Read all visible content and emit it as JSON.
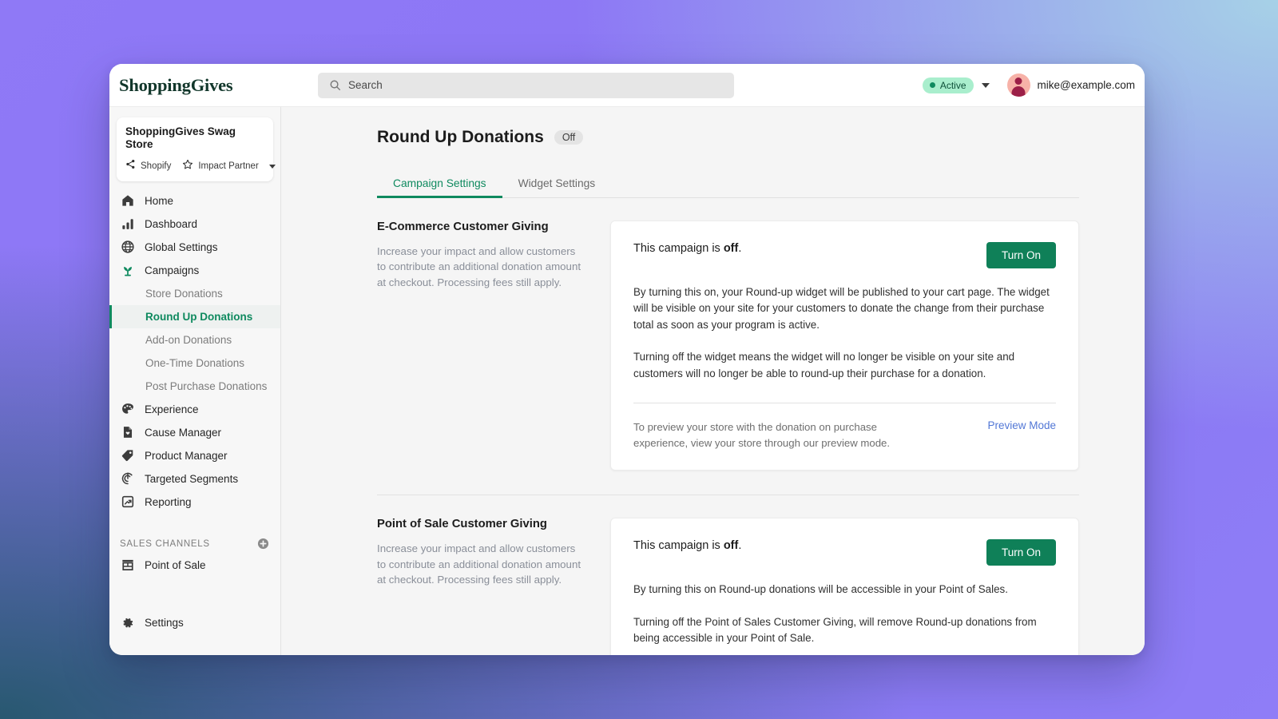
{
  "topbar": {
    "brand": "ShoppingGives",
    "search_placeholder": "Search",
    "status_label": "Active",
    "user_email": "mike@example.com"
  },
  "sidebar": {
    "store": {
      "name": "ShoppingGives Swag Store",
      "platform": "Shopify",
      "partner": "Impact Partner"
    },
    "items": [
      {
        "label": "Home",
        "icon": "home-icon"
      },
      {
        "label": "Dashboard",
        "icon": "bar-chart-icon"
      },
      {
        "label": "Global Settings",
        "icon": "globe-icon"
      },
      {
        "label": "Campaigns",
        "icon": "plant-icon"
      }
    ],
    "campaign_children": [
      {
        "label": "Store Donations",
        "active": false
      },
      {
        "label": "Round Up Donations",
        "active": true
      },
      {
        "label": "Add-on Donations",
        "active": false
      },
      {
        "label": "One-Time Donations",
        "active": false
      },
      {
        "label": "Post Purchase Donations",
        "active": false
      }
    ],
    "items_lower": [
      {
        "label": "Experience",
        "icon": "palette-icon"
      },
      {
        "label": "Cause Manager",
        "icon": "document-heart-icon"
      },
      {
        "label": "Product Manager",
        "icon": "tag-icon"
      },
      {
        "label": "Targeted Segments",
        "icon": "target-icon"
      },
      {
        "label": "Reporting",
        "icon": "report-trend-icon"
      }
    ],
    "sales_channels_title": "SALES CHANNELS",
    "sales_channels": [
      {
        "label": "Point of Sale",
        "icon": "storefront-icon"
      }
    ],
    "footer": [
      {
        "label": "Settings",
        "icon": "gear-icon"
      }
    ]
  },
  "main": {
    "page_title": "Round Up Donations",
    "page_status": "Off",
    "tabs": [
      {
        "label": "Campaign Settings",
        "active": true
      },
      {
        "label": "Widget Settings",
        "active": false
      }
    ],
    "sections": [
      {
        "title": "E-Commerce Customer Giving",
        "description": "Increase your impact and allow customers to contribute an additional donation amount at checkout. Processing fees still apply.",
        "state_prefix": "This campaign is ",
        "state_value": "off",
        "state_suffix": ".",
        "button": "Turn On",
        "paragraph_1": "By turning this on, your Round-up widget will be published to your cart page. The widget will be visible on your site for your customers to donate the change from their purchase total as soon as your program is active.",
        "paragraph_2": "Turning off the widget means the widget will no longer be visible on your site and customers will no longer be able to round-up their purchase for a donation.",
        "footer_note": "To preview your store with the donation on purchase experience, view your store through our preview mode.",
        "footer_link": "Preview Mode"
      },
      {
        "title": "Point of Sale Customer Giving",
        "description": "Increase your impact and allow customers to contribute an additional donation amount at checkout. Processing fees still apply.",
        "state_prefix": "This campaign is ",
        "state_value": "off",
        "state_suffix": ".",
        "button": "Turn On",
        "paragraph_1": "By turning this on Round-up donations will be accessible in your Point of Sales.",
        "paragraph_2": "Turning off the Point of Sales Customer Giving, will remove Round-up donations from being accessible in your Point of Sale."
      }
    ]
  },
  "colors": {
    "brand_green": "#0f8a5f",
    "button_green": "#0f8058",
    "link_blue": "#5277d6",
    "status_pill_bg": "#a9eecd",
    "desktop_purple": "#8c76f5",
    "desktop_teal": "#285870",
    "desktop_blue": "#a8d6e6"
  }
}
